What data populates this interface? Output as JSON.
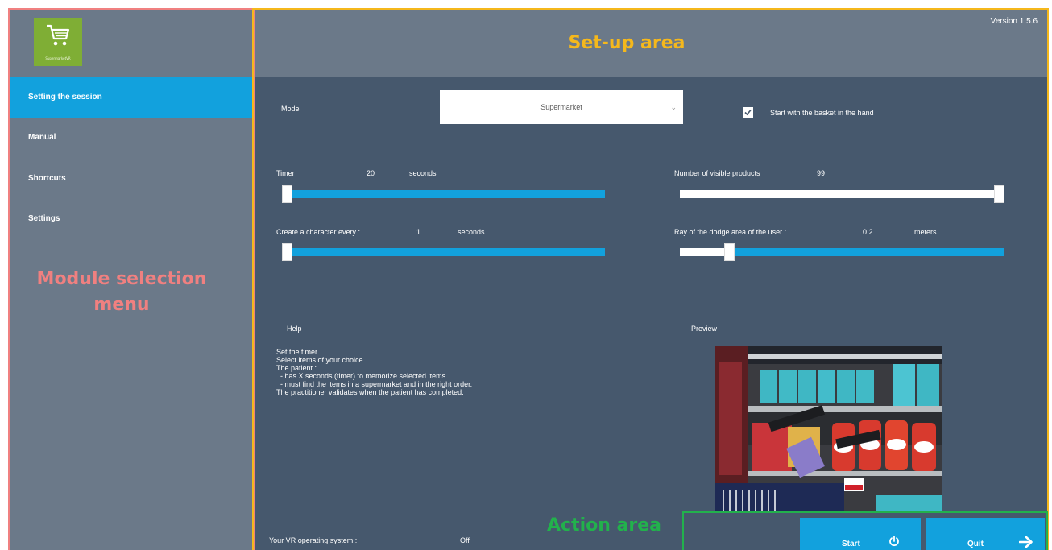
{
  "window": {
    "version": "Version 1.5.6"
  },
  "logo": {
    "text": "SupermarketVR"
  },
  "sidebar": {
    "items": [
      {
        "label": "Setting the session",
        "active": true
      },
      {
        "label": "Manual",
        "active": false
      },
      {
        "label": "Shortcuts",
        "active": false
      },
      {
        "label": "Settings",
        "active": false
      }
    ]
  },
  "annotations": {
    "setup_area": "Set-up area",
    "module_menu": "Module selection menu",
    "action_area": "Action area",
    "colors": {
      "setup": "#f5b81c",
      "module": "#f08080",
      "action": "#22b14c"
    }
  },
  "setup": {
    "mode": {
      "label": "Mode",
      "selected": "Supermarket"
    },
    "basket": {
      "label": "Start with the basket in the hand",
      "checked": true
    },
    "timer": {
      "label": "Timer",
      "value": "20",
      "unit": "seconds",
      "fraction": 0.0
    },
    "visible_products": {
      "label": "Number of visible products",
      "value": "99",
      "fraction": 1.0
    },
    "character": {
      "label": "Create a character every :",
      "value": "1",
      "unit": "seconds",
      "fraction": 0.0
    },
    "dodge": {
      "label": "Ray of the dodge area of the user :",
      "value": "0.2",
      "unit": "meters",
      "fraction": 0.14
    },
    "help": {
      "title": "Help",
      "lines": [
        "Set the timer.",
        "Select items of your choice.",
        "",
        "The patient :",
        "  - has X seconds (timer) to memorize selected items.",
        "  - must find the items in a supermarket and in the right order.",
        "",
        "The practitioner validates when the patient has completed."
      ]
    },
    "preview": {
      "title": "Preview"
    },
    "vr_os": {
      "label": "Your VR operating system :",
      "value": "Off"
    }
  },
  "actions": {
    "start": {
      "label": "Start",
      "icon": "power-icon"
    },
    "quit": {
      "label": "Quit",
      "icon": "arrow-right-icon"
    }
  },
  "colors": {
    "accent": "#12a1dd",
    "panel": "#46586d",
    "header": "#6b7989"
  }
}
